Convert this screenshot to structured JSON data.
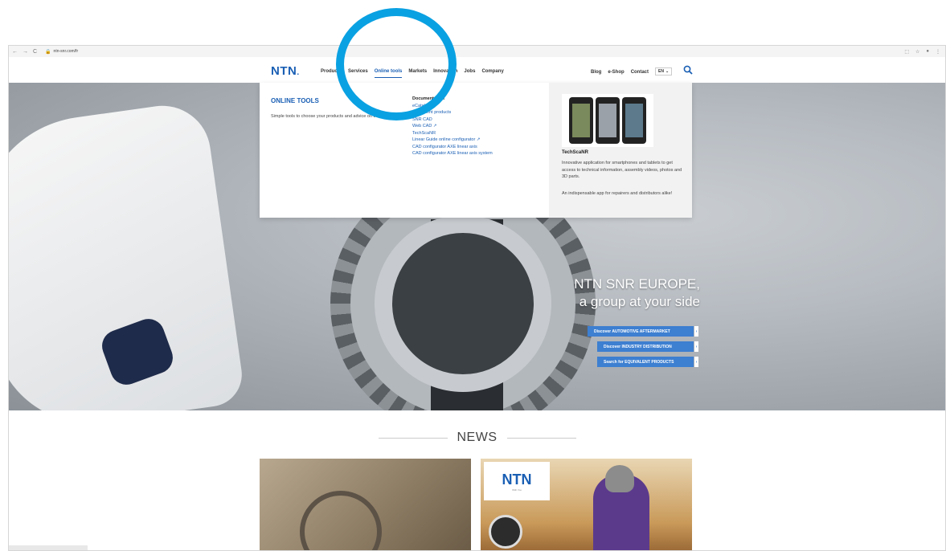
{
  "browser": {
    "url": "ntn-snr.com/fr",
    "back_icon": "←",
    "forward_icon": "→",
    "reload_icon": "C"
  },
  "header": {
    "logo": "NTN",
    "nav": [
      "Products",
      "Services",
      "Online tools",
      "Markets",
      "Innovation",
      "Jobs",
      "Company"
    ],
    "util_nav": [
      "Blog",
      "e-Shop",
      "Contact"
    ],
    "lang": "EN"
  },
  "dropdown": {
    "title": "ONLINE TOOLS",
    "description": "Simple tools to choose your products and advice on their use.",
    "links_head": "Documentation",
    "links": [
      "eCatalogue",
      "Equivalent products",
      "SNR CAD",
      "Web CAD",
      "TechScaNR",
      "Linear Guide online configurator",
      "CAD configurator AXE linear axis",
      "CAD configurator AXE linear axis system"
    ],
    "app_name": "TechScaNR",
    "app_desc": "Innovative application for smartphones and tablets to get access to technical information, assembly videos, photos and 3D parts.",
    "app_note": "An indispensable app for repairers and distributors alike!"
  },
  "hero": {
    "title_line1": "NTN SNR EUROPE,",
    "title_line2": "a group at your side",
    "cta1": "Discover AUTOMOTIVE AFTERMARKET",
    "cta2": "Discover INDUSTRY DISTRIBUTION",
    "cta3": "Search for EQUIVALENT PRODUCTS"
  },
  "news": {
    "title": "NEWS",
    "card2_logo": "NTN",
    "card2_tagline": "With You"
  },
  "colors": {
    "brand": "#1a5fb4",
    "cta": "#3d7fd1",
    "highlight": "#0aa1e2"
  }
}
